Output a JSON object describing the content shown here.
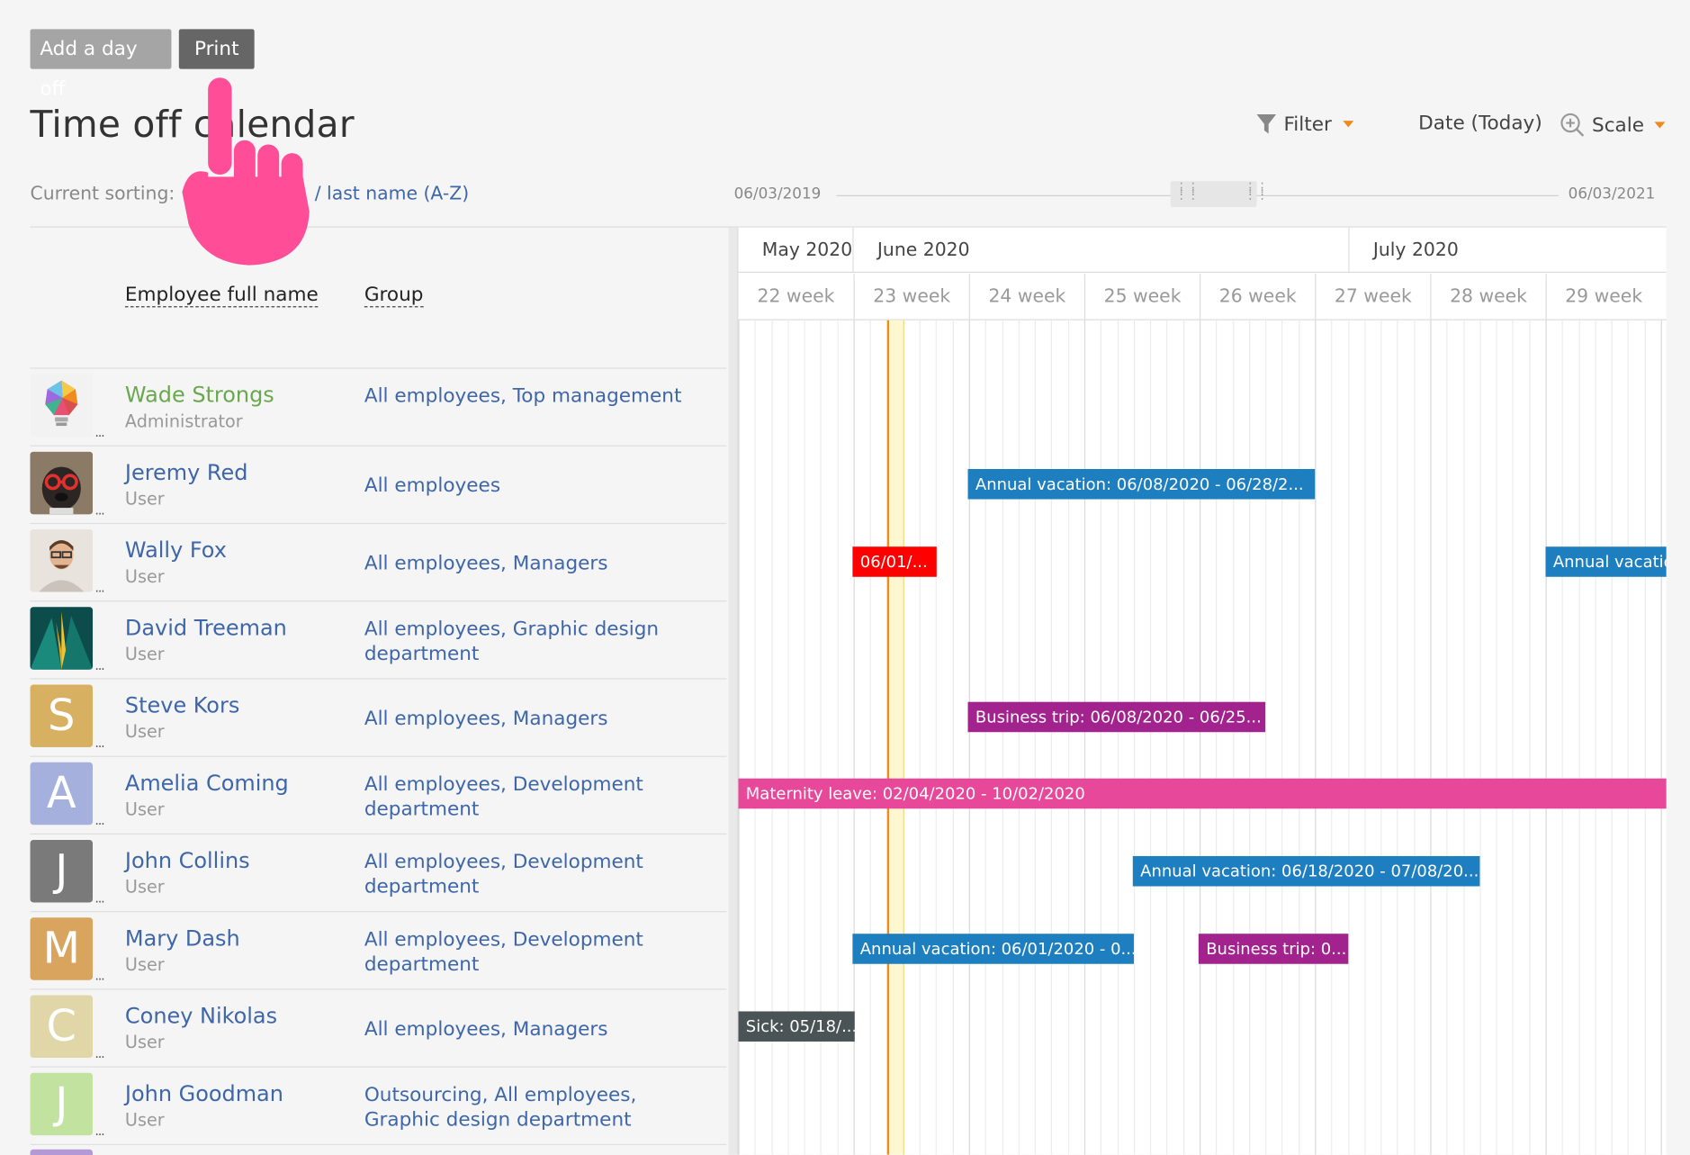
{
  "toolbar": {
    "add_day_off_label": "Add a day off",
    "print_label": "Print"
  },
  "page_title": "Time off calendar",
  "tools": {
    "filter_label": "Filter",
    "date_label": "Date (Today)",
    "scale_label": "Scale"
  },
  "sorting": {
    "label": "Current sorting:",
    "value": "/ last name (A-Z)"
  },
  "range": {
    "start": "06/03/2019",
    "end": "06/03/2021"
  },
  "columns": {
    "name": "Employee full name",
    "group": "Group"
  },
  "employees": [
    {
      "name": "Wade Strongs",
      "role": "Administrator",
      "group": "All employees, Top management",
      "avatar_letter": "",
      "avatar_color": "#f2f2f2"
    },
    {
      "name": "Jeremy Red",
      "role": "User",
      "group": "All employees",
      "avatar_letter": "",
      "avatar_color": "#6b5a48"
    },
    {
      "name": "Wally Fox",
      "role": "User",
      "group": "All employees, Managers",
      "avatar_letter": "",
      "avatar_color": "#d9cfc4"
    },
    {
      "name": "David Treeman",
      "role": "User",
      "group": "All employees, Graphic design department",
      "avatar_letter": "",
      "avatar_color": "#0f5c5a"
    },
    {
      "name": "Steve Kors",
      "role": "User",
      "group": "All employees, Managers",
      "avatar_letter": "S",
      "avatar_color": "#d7b062"
    },
    {
      "name": "Amelia Coming",
      "role": "User",
      "group": "All employees, Development department",
      "avatar_letter": "A",
      "avatar_color": "#a5b0dc"
    },
    {
      "name": "John Collins",
      "role": "User",
      "group": "All employees, Development department",
      "avatar_letter": "J",
      "avatar_color": "#7a7a7a"
    },
    {
      "name": "Mary Dash",
      "role": "User",
      "group": "All employees, Development department",
      "avatar_letter": "M",
      "avatar_color": "#d9a45e"
    },
    {
      "name": "Coney Nikolas",
      "role": "User",
      "group": "All employees, Managers",
      "avatar_letter": "C",
      "avatar_color": "#e0d6a8"
    },
    {
      "name": "John Goodman",
      "role": "User",
      "group": "Outsourcing, All employees, Graphic design department",
      "avatar_letter": "J",
      "avatar_color": "#c2e3a0"
    }
  ],
  "calendar": {
    "months": [
      "May 2020",
      "June 2020",
      "July 2020"
    ],
    "weeks": [
      "22 week",
      "23 week",
      "24 week",
      "25 week",
      "26 week",
      "27 week",
      "28 week",
      "29 week"
    ]
  },
  "bars": [
    {
      "row": 1,
      "label": "Annual vacation: 06/08/2020 - 06/28/2...",
      "color": "blue"
    },
    {
      "row": 2,
      "label": "06/01/...",
      "color": "red"
    },
    {
      "row": 2,
      "label": "Annual vacatio",
      "color": "blue"
    },
    {
      "row": 4,
      "label": "Business trip: 06/08/2020 - 06/25...",
      "color": "purple"
    },
    {
      "row": 5,
      "label": "Maternity leave: 02/04/2020 - 10/02/2020",
      "color": "pink"
    },
    {
      "row": 6,
      "label": "Annual vacation: 06/18/2020 - 07/08/20...",
      "color": "blue"
    },
    {
      "row": 7,
      "label": "Annual vacation: 06/01/2020 - 0...",
      "color": "blue"
    },
    {
      "row": 7,
      "label": "Business trip: 0...",
      "color": "purple"
    },
    {
      "row": 8,
      "label": "Sick: 05/18/...",
      "color": "dark"
    }
  ],
  "colors": {
    "accent": "#f08a1c",
    "link": "#3e66a8",
    "admin": "#6aa84f",
    "cursor": "#ff4d97"
  }
}
